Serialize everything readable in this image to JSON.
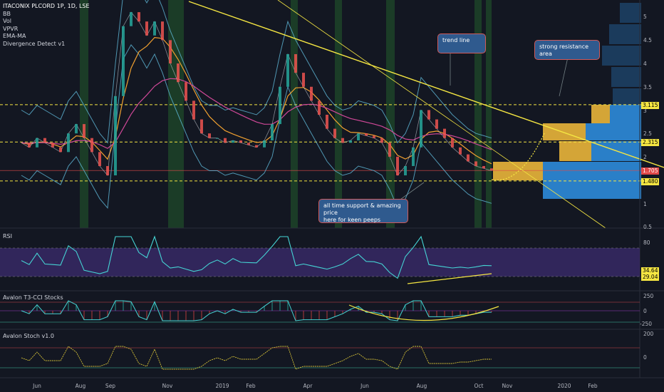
{
  "legend": {
    "title": "ITACONIX PLCORD 1P, 1D, LSE",
    "indicators": [
      "BB",
      "Vol",
      "VPVR",
      "EMA-MA",
      "Divergence Detect v1"
    ]
  },
  "annotations": {
    "trend_line": "trend line",
    "resistance": "strong resistance area",
    "support_line1": "all time support & amazing price",
    "support_line2": "here for keen peeps"
  },
  "panes": {
    "rsi": "RSI",
    "cci": "Avalon T3-CCI Stocks",
    "stoch": "Avalon Stoch v1.0"
  },
  "price_tags": {
    "resistance": "3.115",
    "mid": "2.315",
    "current": "1.705",
    "support": "1.480",
    "rsi_value": "29.04",
    "rsi_value2": "34.64"
  },
  "colors": {
    "background": "#131722",
    "price": "#d1d4dc",
    "bb": "#5fb8d8",
    "ema": "#f0a030",
    "ma": "#d04898",
    "trend": "#f5e642",
    "vpvr_blue": "#2a7fc8",
    "vpvr_gold": "#d4a537",
    "rsi_line": "#45d4d4",
    "rsi_band": "#3a2a6a"
  },
  "chart_data": {
    "type": "line",
    "title": "ITACONIX PLCORD 1P, 1D, LSE",
    "x_ticks": [
      "Jun",
      "Aug",
      "Sep",
      "Nov",
      "2019",
      "Feb",
      "Apr",
      "Jun",
      "Aug",
      "Oct",
      "Nov",
      "2020",
      "Feb"
    ],
    "y_ticks": [
      5.0,
      4.5,
      4.0,
      3.5,
      3.0,
      2.5,
      2.0,
      1.5,
      1.0,
      0.5
    ],
    "ylim": [
      0.5,
      5.3
    ],
    "price_series": [
      2.3,
      2.2,
      2.4,
      2.3,
      2.2,
      2.1,
      2.5,
      2.7,
      2.4,
      2.1,
      1.8,
      1.6,
      3.3,
      4.8,
      5.1,
      4.9,
      4.6,
      4.9,
      4.5,
      4.0,
      3.6,
      3.2,
      2.8,
      2.5,
      2.4,
      2.4,
      2.3,
      2.35,
      2.3,
      2.25,
      2.2,
      2.35,
      2.7,
      3.5,
      4.2,
      3.8,
      3.5,
      3.2,
      2.9,
      2.6,
      2.4,
      2.3,
      2.35,
      2.5,
      2.45,
      2.4,
      2.3,
      2.0,
      1.6,
      1.8,
      2.2,
      3.0,
      2.8,
      2.6,
      2.4,
      2.2,
      2.05,
      1.9,
      1.8,
      1.75,
      1.7
    ],
    "key_levels": [
      3.115,
      2.315,
      1.48
    ],
    "rsi": {
      "ylim": [
        0,
        100
      ],
      "y_ticks": [
        80
      ],
      "current": 29.04
    },
    "cci": {
      "y_ticks": [
        250.0,
        0.0,
        -250.0
      ]
    },
    "stoch": {
      "y_ticks": [
        200.0,
        0.0
      ]
    }
  }
}
